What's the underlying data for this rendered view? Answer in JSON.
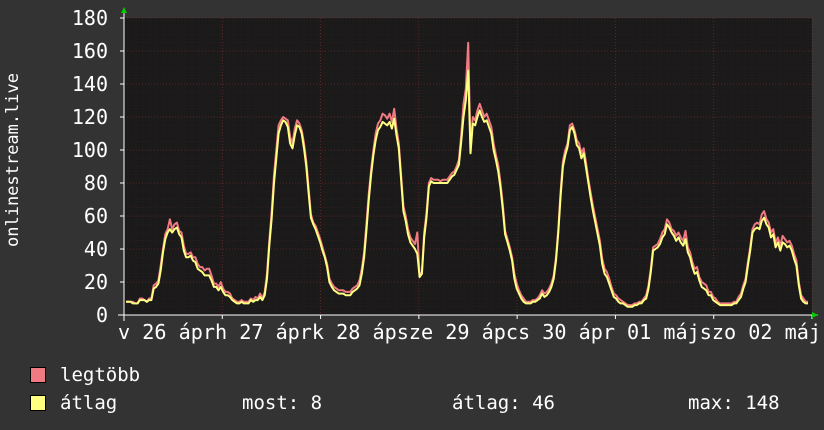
{
  "chart_data": {
    "type": "line",
    "ylabel": "onlinestream.live",
    "ylim": [
      0,
      180
    ],
    "y_ticks": [
      0,
      20,
      40,
      60,
      80,
      100,
      120,
      140,
      160,
      180
    ],
    "x_tick_labels": [
      "v 26 ápr",
      "h 27 ápr",
      "k 28 ápr",
      "sze 29 ápr",
      "cs 30 ápr",
      "p 01 máj",
      "szo 02 máj"
    ],
    "x_tick_label_text": "v 26 áprh 27 áprk 28 ápsze 29 ápcs 30 ápr 01 májszo 02 máj",
    "grid": true,
    "background_color": "#1a1a1a",
    "grid_color": "#aa3333",
    "axis_color": "#ffffff",
    "series": [
      {
        "name": "legtöbb",
        "color": "#f07a82",
        "values": [
          8,
          8,
          8,
          8,
          7,
          7,
          10,
          10,
          9,
          8,
          10,
          10,
          18,
          19,
          21,
          30,
          40,
          49,
          52,
          58,
          52,
          55,
          56,
          51,
          50,
          42,
          37,
          37,
          38,
          35,
          35,
          31,
          29,
          29,
          27,
          28,
          28,
          24,
          19,
          19,
          17,
          20,
          16,
          14,
          14,
          13,
          10,
          9,
          8,
          8,
          9,
          8,
          8,
          8,
          10,
          9,
          11,
          10,
          13,
          10,
          14,
          25,
          45,
          62,
          85,
          100,
          115,
          118,
          120,
          119,
          118,
          108,
          104,
          113,
          118,
          116,
          112,
          104,
          93,
          77,
          61,
          56,
          54,
          50,
          46,
          41,
          36,
          31,
          22,
          19,
          17,
          16,
          15,
          15,
          15,
          14,
          14,
          14,
          16,
          17,
          18,
          21,
          28,
          38,
          55,
          73,
          88,
          100,
          110,
          116,
          118,
          122,
          121,
          119,
          122,
          117,
          125,
          113,
          104,
          85,
          66,
          60,
          52,
          47,
          45,
          43,
          50,
          24,
          26,
          50,
          62,
          80,
          83,
          82,
          82,
          82,
          81,
          82,
          82,
          82,
          84,
          86,
          87,
          90,
          94,
          109,
          128,
          137,
          165,
          100,
          120,
          118,
          124,
          128,
          124,
          120,
          122,
          118,
          114,
          104,
          97,
          91,
          80,
          67,
          51,
          46,
          41,
          35,
          25,
          19,
          15,
          12,
          10,
          8,
          8,
          8,
          9,
          9,
          10,
          12,
          15,
          13,
          14,
          16,
          19,
          24,
          35,
          52,
          75,
          93,
          100,
          104,
          115,
          116,
          112,
          106,
          104,
          98,
          101,
          92,
          82,
          74,
          66,
          59,
          52,
          45,
          34,
          28,
          26,
          22,
          17,
          13,
          12,
          10,
          9,
          8,
          7,
          6,
          6,
          6,
          7,
          7,
          8,
          8,
          10,
          12,
          18,
          28,
          41,
          42,
          43,
          46,
          50,
          52,
          58,
          56,
          52,
          51,
          48,
          50,
          47,
          45,
          51,
          41,
          38,
          32,
          28,
          29,
          23,
          20,
          19,
          18,
          14,
          14,
          11,
          10,
          8,
          7,
          7,
          7,
          7,
          7,
          7,
          8,
          8,
          11,
          13,
          18,
          22,
          32,
          41,
          52,
          55,
          56,
          55,
          61,
          63,
          58,
          56,
          50,
          52,
          44,
          47,
          42,
          48,
          46,
          44,
          45,
          42,
          37,
          33,
          20,
          12,
          10,
          8,
          8
        ]
      },
      {
        "name": "átlag",
        "color": "#ffff80",
        "values": [
          8,
          8,
          8,
          7,
          7,
          7,
          9,
          9,
          9,
          8,
          9,
          9,
          16,
          17,
          19,
          27,
          38,
          46,
          50,
          52,
          50,
          52,
          53,
          49,
          47,
          39,
          35,
          35,
          36,
          33,
          32,
          28,
          27,
          26,
          24,
          24,
          24,
          21,
          17,
          17,
          15,
          17,
          14,
          12,
          12,
          11,
          9,
          8,
          7,
          7,
          8,
          7,
          7,
          7,
          9,
          8,
          9,
          9,
          11,
          9,
          12,
          22,
          42,
          58,
          80,
          95,
          110,
          115,
          118,
          117,
          114,
          104,
          101,
          109,
          115,
          114,
          110,
          101,
          90,
          74,
          59,
          55,
          52,
          48,
          44,
          39,
          35,
          29,
          20,
          17,
          15,
          14,
          13,
          13,
          13,
          12,
          12,
          12,
          14,
          15,
          16,
          18,
          25,
          35,
          51,
          69,
          85,
          97,
          106,
          112,
          114,
          117,
          116,
          115,
          117,
          113,
          119,
          109,
          101,
          82,
          63,
          57,
          49,
          44,
          42,
          40,
          37,
          23,
          25,
          47,
          59,
          78,
          81,
          80,
          80,
          80,
          80,
          80,
          80,
          80,
          82,
          84,
          85,
          88,
          91,
          105,
          120,
          130,
          148,
          98,
          116,
          115,
          120,
          124,
          120,
          117,
          118,
          114,
          110,
          100,
          94,
          87,
          77,
          64,
          49,
          44,
          39,
          33,
          22,
          16,
          13,
          10,
          8,
          7,
          7,
          7,
          8,
          8,
          9,
          10,
          13,
          11,
          12,
          14,
          17,
          22,
          33,
          50,
          72,
          90,
          97,
          102,
          112,
          114,
          110,
          103,
          101,
          95,
          98,
          89,
          80,
          71,
          63,
          56,
          49,
          42,
          31,
          25,
          23,
          19,
          15,
          11,
          10,
          8,
          7,
          7,
          6,
          5,
          5,
          5,
          6,
          6,
          7,
          7,
          9,
          10,
          16,
          26,
          39,
          40,
          41,
          43,
          47,
          49,
          55,
          53,
          50,
          48,
          45,
          47,
          44,
          42,
          46,
          38,
          35,
          29,
          25,
          26,
          21,
          17,
          16,
          15,
          12,
          12,
          9,
          8,
          7,
          6,
          6,
          6,
          6,
          6,
          6,
          7,
          7,
          9,
          11,
          16,
          20,
          30,
          39,
          50,
          52,
          53,
          52,
          57,
          59,
          55,
          53,
          47,
          49,
          41,
          44,
          39,
          44,
          43,
          41,
          42,
          39,
          34,
          30,
          18,
          10,
          8,
          7,
          7
        ]
      }
    ]
  },
  "legend": [
    {
      "label": "legtöbb",
      "color": "#f07a82"
    },
    {
      "label": "átlag",
      "color": "#ffff80"
    }
  ],
  "stats": {
    "now": "most: 8",
    "avg": "átlag: 46",
    "max": "max: 148"
  }
}
